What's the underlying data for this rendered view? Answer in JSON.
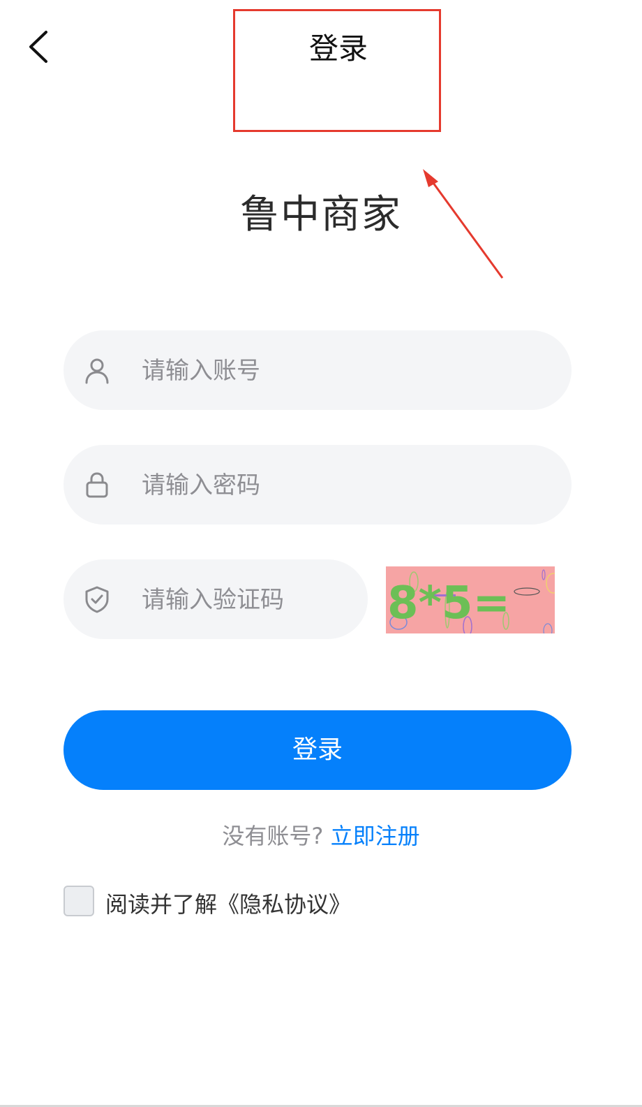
{
  "nav": {
    "title": "登录"
  },
  "app": {
    "name": "鲁中商家"
  },
  "form": {
    "account_placeholder": "请输入账号",
    "password_placeholder": "请输入密码",
    "captcha_placeholder": "请输入验证码",
    "captcha_text": "8*5="
  },
  "actions": {
    "login_label": "登录",
    "register_question": "没有账号?",
    "register_link": "立即注册"
  },
  "agreement": {
    "label": "阅读并了解《隐私协议》"
  },
  "colors": {
    "primary": "#0580fb",
    "annotation": "#e53a2e",
    "field_bg": "#f4f5f7"
  }
}
